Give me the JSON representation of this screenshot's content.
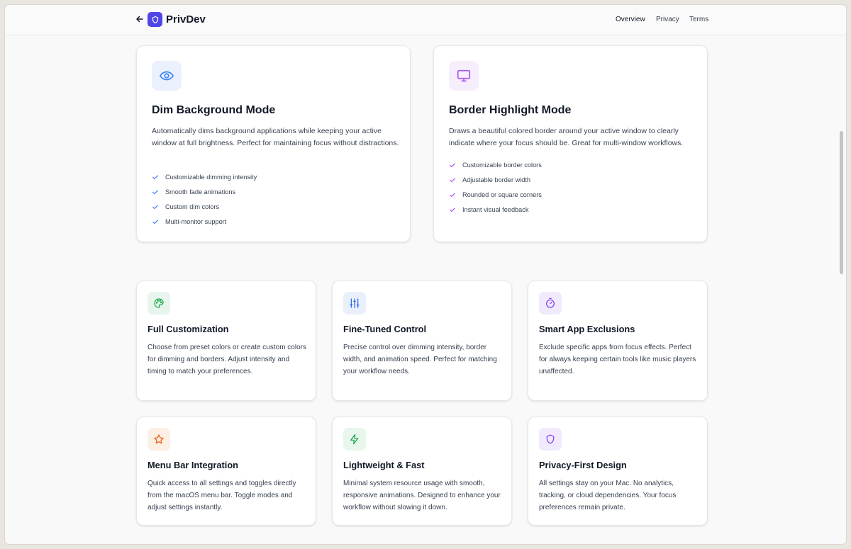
{
  "header": {
    "brand": "PrivDev",
    "nav": [
      "Overview",
      "Privacy",
      "Terms"
    ]
  },
  "modes": [
    {
      "icon": "eye-icon",
      "title": "Dim Background Mode",
      "description": "Automatically dims background applications while keeping your active window at full brightness. Perfect for maintaining focus without distractions.",
      "features": [
        "Customizable dimming intensity",
        "Smooth fade animations",
        "Custom dim colors",
        "Multi-monitor support"
      ]
    },
    {
      "icon": "monitor-icon",
      "title": "Border Highlight Mode",
      "description": "Draws a beautiful colored border around your active window to clearly indicate where your focus should be. Great for multi-window workflows.",
      "features": [
        "Customizable border colors",
        "Adjustable border width",
        "Rounded or square corners",
        "Instant visual feedback"
      ]
    }
  ],
  "features": [
    {
      "icon": "palette-icon",
      "title": "Full Customization",
      "description": "Choose from preset colors or create custom colors for dimming and borders. Adjust intensity and timing to match your preferences."
    },
    {
      "icon": "sliders-icon",
      "title": "Fine-Tuned Control",
      "description": "Precise control over dimming intensity, border width, and animation speed. Perfect for matching your workflow needs."
    },
    {
      "icon": "timer-icon",
      "title": "Smart App Exclusions",
      "description": "Exclude specific apps from focus effects. Perfect for always keeping certain tools like music players unaffected."
    },
    {
      "icon": "star-icon",
      "title": "Menu Bar Integration",
      "description": "Quick access to all settings and toggles directly from the macOS menu bar. Toggle modes and adjust settings instantly."
    },
    {
      "icon": "lightning-icon",
      "title": "Lightweight & Fast",
      "description": "Minimal system resource usage with smooth, responsive animations. Designed to enhance your workflow without slowing it down."
    },
    {
      "icon": "shield-icon",
      "title": "Privacy-First Design",
      "description": "All settings stay on your Mac. No analytics, tracking, or cloud dependencies. Your focus preferences remain private."
    }
  ],
  "colors": {
    "brand": "#4f46e5",
    "eye": "#3b82f6",
    "monitor": "#a855f7",
    "palette": "#16a34a",
    "sliders": "#2563eb",
    "timer": "#7c3aed",
    "star": "#ea580c",
    "lightning": "#16a34a",
    "shield": "#7c3aed"
  }
}
